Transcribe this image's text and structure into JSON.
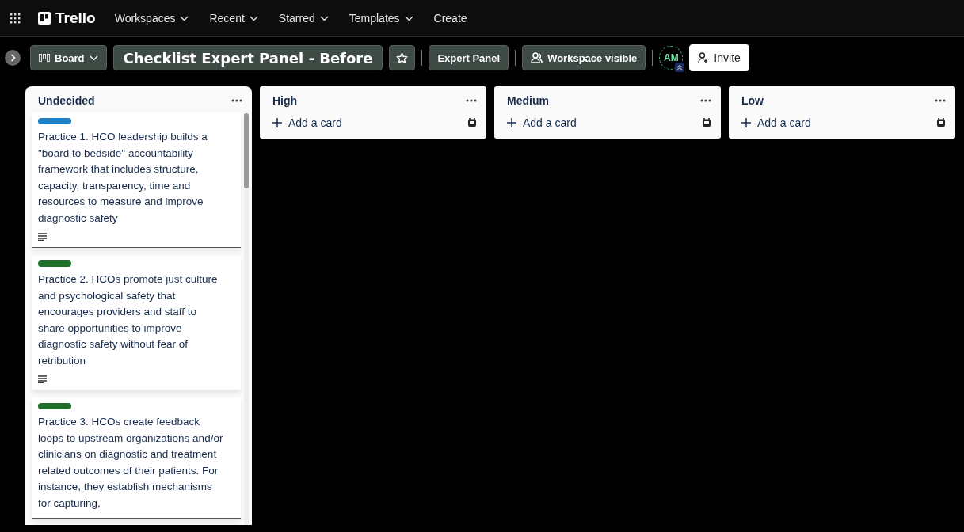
{
  "nav": {
    "logo": "Trello",
    "items": [
      {
        "label": "Workspaces",
        "dropdown": true
      },
      {
        "label": "Recent",
        "dropdown": true
      },
      {
        "label": "Starred",
        "dropdown": true
      },
      {
        "label": "Templates",
        "dropdown": true
      },
      {
        "label": "Create",
        "dropdown": false
      }
    ]
  },
  "board": {
    "view": "Board",
    "title": "Checklist Expert Panel - Before",
    "starred": false,
    "workspace": "Expert Panel",
    "visibility": "Workspace visible",
    "members": [
      {
        "initials": "AM"
      }
    ],
    "invite": "Invite"
  },
  "lists": [
    {
      "title": "Undecided",
      "cards": [
        {
          "color": "#1f7fc7",
          "text": "Practice 1. HCO leadership builds a \"board to bedside\" accountability framework that includes structure, capacity, transparency, time and resources to measure and improve diagnostic safety",
          "has_description": true
        },
        {
          "color": "#1e6e2a",
          "text": "Practice 2. HCOs promote just culture and psychological safety that encourages providers and staff to share opportunities to improve diagnostic safety without fear of retribution",
          "has_description": true
        },
        {
          "color": "#1e6e2a",
          "text": "Practice 3. HCOs create feedback loops to upstream organizations and/or clinicians on diagnostic and treatment related outcomes of their patients. For instance, they establish mechanisms for capturing,",
          "has_description": false
        }
      ]
    },
    {
      "title": "High",
      "add_card": "Add a card"
    },
    {
      "title": "Medium",
      "add_card": "Add a card"
    },
    {
      "title": "Low",
      "add_card": "Add a card"
    }
  ]
}
